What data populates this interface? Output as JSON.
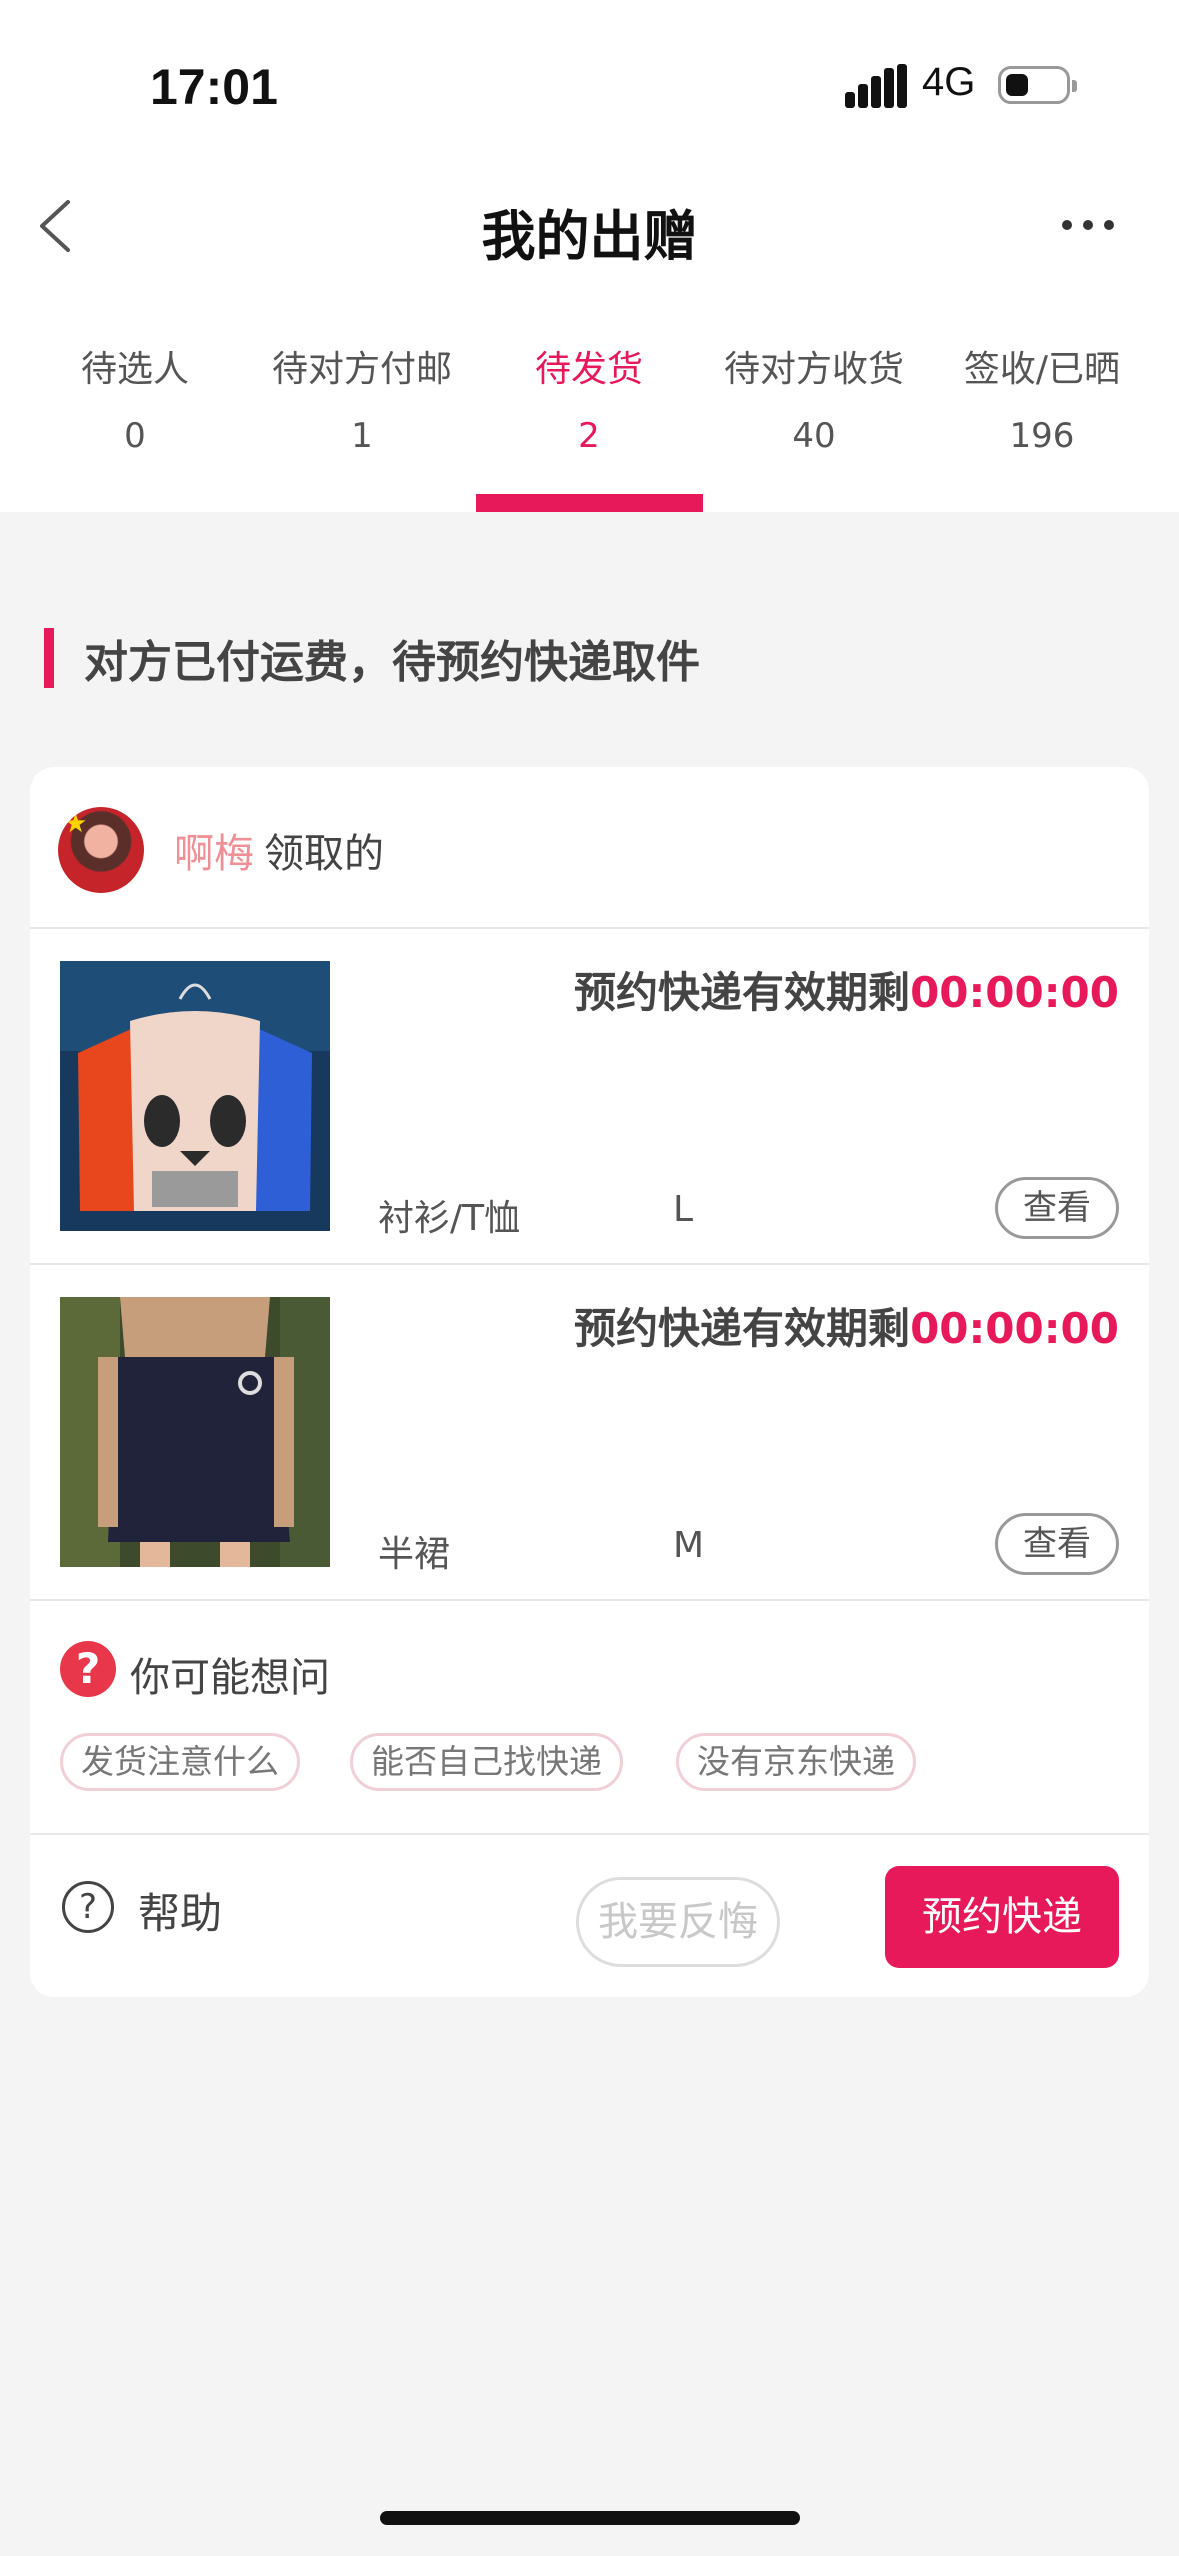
{
  "status_bar": {
    "time": "17:01",
    "network": "4G",
    "battery_icon": "battery-low-icon"
  },
  "nav": {
    "title": "我的出赠",
    "back_icon": "chevron-left-icon",
    "more_icon": "more-dots-icon"
  },
  "tabs": [
    {
      "label": "待选人",
      "count": "0"
    },
    {
      "label": "待对方付邮",
      "count": "1"
    },
    {
      "label": "待发货",
      "count": "2",
      "active": true
    },
    {
      "label": "待对方收货",
      "count": "40"
    },
    {
      "label": "签收/已晒",
      "count": "196"
    }
  ],
  "section": {
    "title": "对方已付运费，待预约快递取件"
  },
  "order": {
    "recipient_name": "啊梅",
    "recipient_action": "领取的",
    "items": [
      {
        "timer_label": "预约快递有效期剩",
        "countdown": "00:00:00",
        "category": "衬衫/T恤",
        "size": "L",
        "view_label": "查看"
      },
      {
        "timer_label": "预约快递有效期剩",
        "countdown": "00:00:00",
        "category": "半裙",
        "size": "M",
        "view_label": "查看"
      }
    ],
    "faq": {
      "title": "你可能想问",
      "icon": "?",
      "chips": [
        "发货注意什么",
        "能否自己找快递",
        "没有京东快递"
      ]
    },
    "footer": {
      "help_icon": "?",
      "help_label": "帮助",
      "regret_label": "我要反悔",
      "book_label": "预约快递"
    }
  },
  "colors": {
    "accent": "#e8195a",
    "name": "#f08f95",
    "background": "#f4f4f4"
  }
}
